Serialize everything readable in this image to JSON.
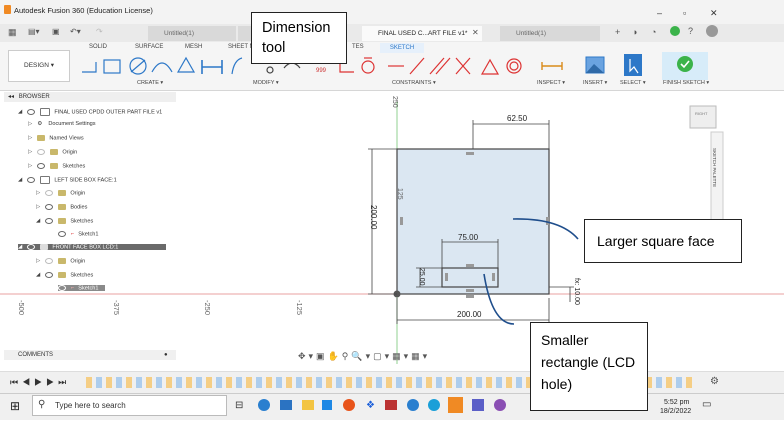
{
  "app": {
    "title": "Autodesk Fusion 360 (Education License)",
    "window_controls": [
      "–",
      "▫",
      "✕"
    ]
  },
  "tabs": [
    {
      "label": "Untitled(1)",
      "active": false
    },
    {
      "label": "Untitled(1)",
      "active": false
    },
    {
      "label": "FINAL USED C...ART FILE v1*",
      "active": true
    },
    {
      "label": "Untitled(1)",
      "active": false
    }
  ],
  "ribbon": {
    "workspace": "DESIGN ▾",
    "tabs": [
      "SOLID",
      "SURFACE",
      "MESH",
      "SHEET M",
      "TES",
      "SKETCH"
    ],
    "groups": {
      "create": "CREATE ▾",
      "modify": "MODIFY ▾",
      "constraints": "CONSTRAINTS ▾",
      "inspect": "INSPECT ▾",
      "insert": "INSERT ▾",
      "select": "SELECT ▾",
      "finish": "FINISH SKETCH ▾"
    },
    "constraint_label": "999"
  },
  "browser": {
    "header": "BROWSER",
    "items": [
      {
        "label": "FINAL USED CPDD OUTER PART FILE v1",
        "indent": 0
      },
      {
        "label": "Document Settings",
        "indent": 1
      },
      {
        "label": "Named Views",
        "indent": 1
      },
      {
        "label": "Origin",
        "indent": 1
      },
      {
        "label": "Sketches",
        "indent": 1
      },
      {
        "label": "LEFT SIDE BOX FACE:1",
        "indent": 1
      },
      {
        "label": "Origin",
        "indent": 2
      },
      {
        "label": "Bodies",
        "indent": 2
      },
      {
        "label": "Sketches",
        "indent": 2
      },
      {
        "label": "Sketch1",
        "indent": 3
      },
      {
        "label": "FRONT FACE  BOX LCD:1",
        "indent": 1,
        "highlight": true
      },
      {
        "label": "Origin",
        "indent": 2
      },
      {
        "label": "Sketches",
        "indent": 2
      },
      {
        "label": "Sketch1",
        "indent": 3,
        "highlight": true
      }
    ]
  },
  "canvas": {
    "axis_labels": [
      "-500",
      "-375",
      "-250",
      "-125"
    ],
    "vertical_label": "250",
    "dim_top": "62.50",
    "dim_height": "200.00",
    "dim_mid": "125",
    "dim_rect_width": "75.00",
    "dim_rect_height": "25.00",
    "dim_bottom": "200.00",
    "dim_offset": "fx: 10.00",
    "viewcube": "RIGHT",
    "palette": "SKETCH PALETTE"
  },
  "comments": "COMMENTS",
  "annotations": {
    "dimension_tool": "Dimension tool",
    "larger_face": "Larger square face",
    "smaller_rect": "Smaller rectangle (LCD hole)"
  },
  "taskbar": {
    "search_placeholder": "Type here to search",
    "time": "5:52 pm",
    "date": "18/2/2022"
  },
  "colors": {
    "accent": "#2d78c8",
    "sketch_fill": "#dbe7f2",
    "origin_red": "#e07070",
    "origin_green": "#7cc47c",
    "finish_green": "#3bb34a",
    "annotation_blue": "#1f4e8c"
  }
}
